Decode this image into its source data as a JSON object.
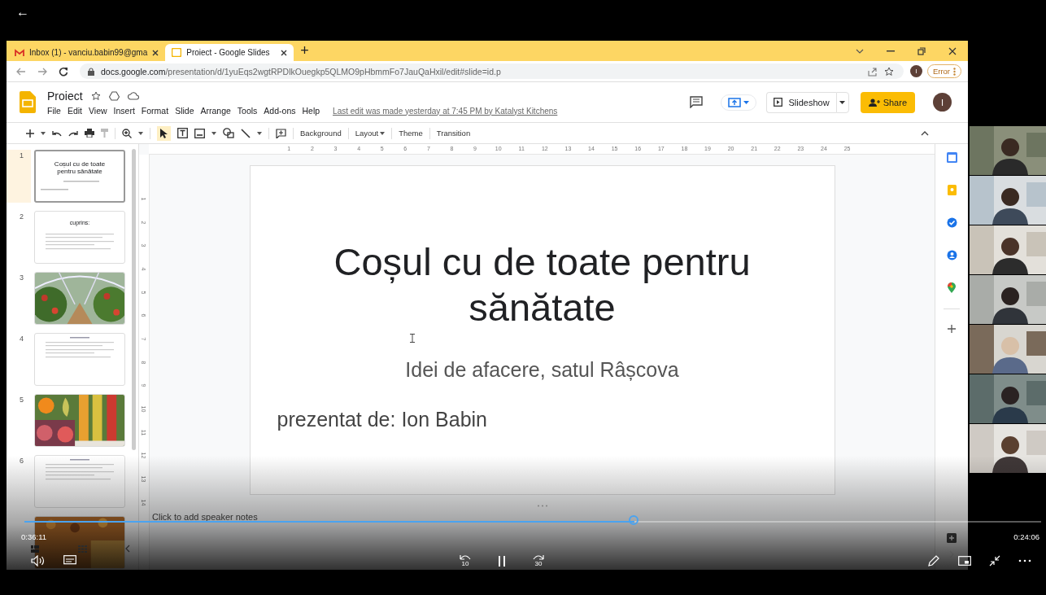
{
  "back": "←",
  "browser": {
    "tabs": [
      {
        "title": "Inbox (1) - vanciu.babin99@gma",
        "selected": false,
        "kind": "mail"
      },
      {
        "title": "Proiect - Google Slides",
        "selected": true,
        "kind": "slides"
      }
    ],
    "new_tab": "+",
    "url_host": "docs.google.com",
    "url_path": "/presentation/d/1yuEqs2wgtRPDlkOuegkp5QLMO9pHbmmFo7JauQaHxil/edit#slide=id.p",
    "profile": "I",
    "error": "Error"
  },
  "doc": {
    "title": "Proiect",
    "menu": [
      "File",
      "Edit",
      "View",
      "Insert",
      "Format",
      "Slide",
      "Arrange",
      "Tools",
      "Add-ons",
      "Help"
    ],
    "last_edit": "Last edit was made yesterday at 7:45 PM by Katalyst Kitchens",
    "slideshow": "Slideshow",
    "share": "Share",
    "avatar": "I"
  },
  "toolbar": {
    "select_active": true,
    "buttons": [
      "Background",
      "Layout",
      "Theme",
      "Transition"
    ]
  },
  "thumbnails": [
    {
      "number": "1",
      "kind": "title",
      "selected": true,
      "title": "Coșul cu de toate pentru sănătate"
    },
    {
      "number": "2",
      "kind": "text",
      "selected": false,
      "title": "cuprins:"
    },
    {
      "number": "3",
      "kind": "picture",
      "selected": false
    },
    {
      "number": "4",
      "kind": "text",
      "selected": false
    },
    {
      "number": "5",
      "kind": "picture",
      "selected": false
    },
    {
      "number": "6",
      "kind": "text",
      "selected": false
    },
    {
      "kind": "picture",
      "selected": false
    }
  ],
  "ruler_h": [
    "1",
    "2",
    "3",
    "4",
    "5",
    "6",
    "7",
    "8",
    "9",
    "10",
    "11",
    "12",
    "13",
    "14",
    "15",
    "16",
    "17",
    "18",
    "19",
    "20",
    "21",
    "22",
    "23",
    "24",
    "25"
  ],
  "ruler_v": [
    "1",
    "2",
    "3",
    "4",
    "5",
    "6",
    "7",
    "8",
    "9",
    "10",
    "11",
    "12",
    "13",
    "14"
  ],
  "slide": {
    "title": "Coșul cu de toate pentru sănătate",
    "subtitle": "Idei de afacere, satul Râșcova",
    "presenter": "prezentat de: Ion Babin"
  },
  "notes_placeholder": "Click to add speaker notes",
  "participants": [
    {
      "kind": "picture"
    },
    {
      "kind": "picture"
    },
    {
      "kind": "picture"
    },
    {
      "kind": "picture"
    },
    {
      "kind": "picture"
    },
    {
      "kind": "picture"
    },
    {
      "kind": "picture"
    }
  ],
  "player": {
    "elapsed": "0:36:11",
    "remaining": "0:24:06",
    "level": 0.6,
    "playing": true,
    "skip_back": "10",
    "skip_forward": "30"
  }
}
